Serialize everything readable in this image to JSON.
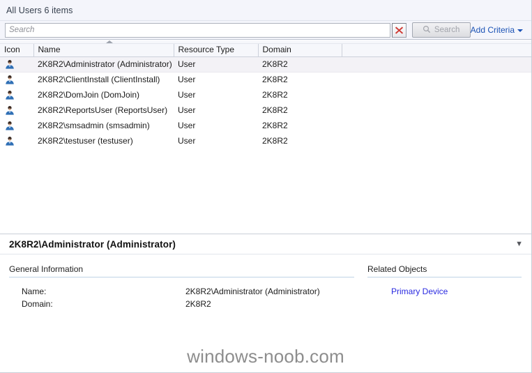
{
  "header": {
    "title": "All Users 6 items"
  },
  "search": {
    "placeholder": "Search",
    "value": "",
    "clear_icon": "red-x-icon",
    "search_button_label": "Search",
    "search_button_icon": "magnifier-icon",
    "add_criteria_label": "Add Criteria",
    "add_criteria_icon": "caret-down-icon"
  },
  "list": {
    "sort_column": "Name",
    "sort_direction": "ascending",
    "columns": [
      "Icon",
      "Name",
      "Resource Type",
      "Domain"
    ],
    "rows": [
      {
        "icon": "user-icon",
        "name": "2K8R2\\Administrator (Administrator)",
        "resource_type": "User",
        "domain": "2K8R2",
        "selected": true
      },
      {
        "icon": "user-icon",
        "name": "2K8R2\\ClientInstall (ClientInstall)",
        "resource_type": "User",
        "domain": "2K8R2",
        "selected": false
      },
      {
        "icon": "user-icon",
        "name": "2K8R2\\DomJoin (DomJoin)",
        "resource_type": "User",
        "domain": "2K8R2",
        "selected": false
      },
      {
        "icon": "user-icon",
        "name": "2K8R2\\ReportsUser (ReportsUser)",
        "resource_type": "User",
        "domain": "2K8R2",
        "selected": false
      },
      {
        "icon": "user-icon",
        "name": "2K8R2\\smsadmin (smsadmin)",
        "resource_type": "User",
        "domain": "2K8R2",
        "selected": false
      },
      {
        "icon": "user-icon",
        "name": "2K8R2\\testuser (testuser)",
        "resource_type": "User",
        "domain": "2K8R2",
        "selected": false
      }
    ]
  },
  "detail": {
    "title": "2K8R2\\Administrator (Administrator)",
    "collapse_icon": "chevron-down-icon",
    "general": {
      "section_title": "General Information",
      "fields": [
        {
          "label": "Name:",
          "value": "2K8R2\\Administrator (Administrator)"
        },
        {
          "label": "Domain:",
          "value": "2K8R2"
        }
      ]
    },
    "related": {
      "section_title": "Related Objects",
      "links": [
        "Primary Device"
      ]
    }
  },
  "watermark": {
    "text": "windows-noob.com"
  },
  "colors": {
    "link": "#1a52b5",
    "related_link": "#2a2ae0",
    "clear_x": "#cf3a34",
    "header_bg": "#f4f5fb",
    "selected_row": "#f3f2f6"
  }
}
